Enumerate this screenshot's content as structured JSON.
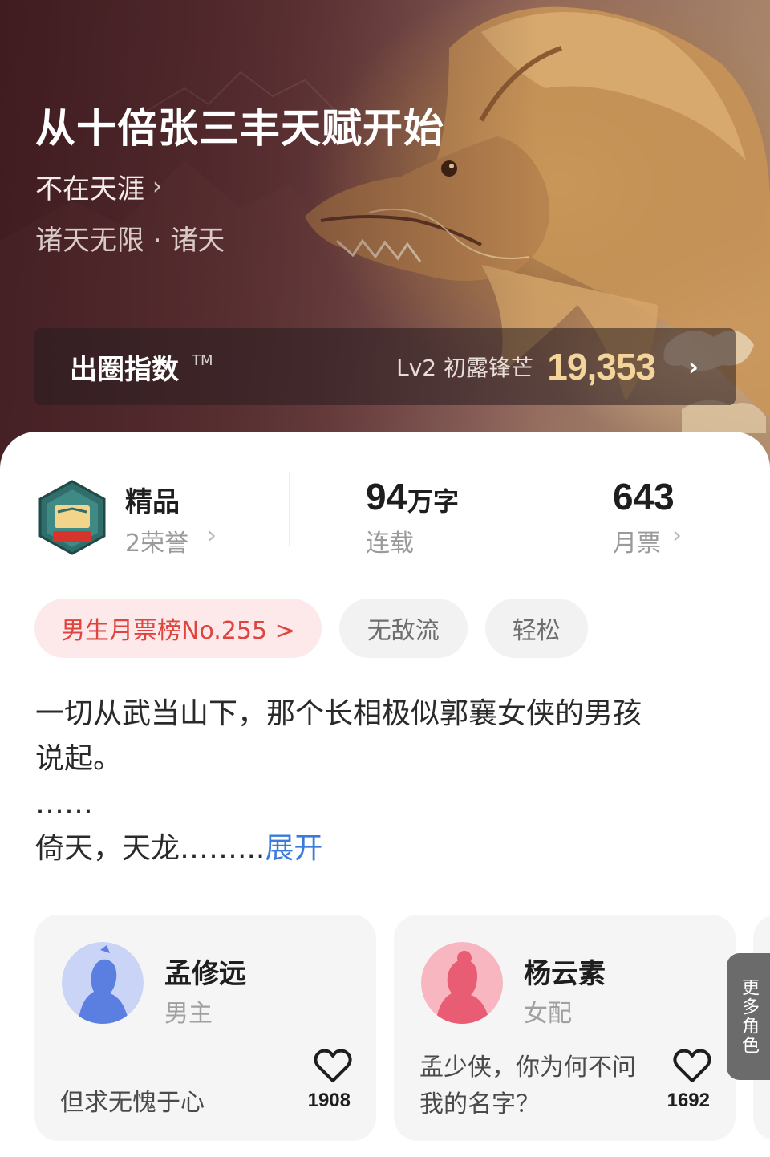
{
  "book": {
    "title": "从十倍张三丰天赋开始",
    "author": "不在天涯",
    "category": "诸天无限 · 诸天"
  },
  "index": {
    "label": "出圈指数",
    "tm": "TM",
    "level": "Lv2 初露锋芒",
    "value": "19,353"
  },
  "stats": {
    "honor_title": "精品",
    "honor_count": "2荣誉",
    "words_num": "94",
    "words_unit": "万字",
    "status": "连载",
    "votes": "643",
    "votes_label": "月票"
  },
  "tags": [
    {
      "label": "男生月票榜No.255 >"
    },
    {
      "label": "无敌流"
    },
    {
      "label": "轻松"
    }
  ],
  "synopsis": {
    "line1": "一切从武当山下，那个长相极似郭襄女侠的男孩",
    "line2": "说起。",
    "line3": "……",
    "line4": "倚天，天龙……...",
    "expand": "展开"
  },
  "characters": [
    {
      "name": "孟修远",
      "role": "男主",
      "quote": "但求无愧于心",
      "likes": "1908"
    },
    {
      "name": "杨云素",
      "role": "女配",
      "quote": "孟少侠，你为何不问我的名字？",
      "likes": "1692"
    }
  ],
  "more_roles": "更多角色",
  "colors": {
    "accent_red": "#e0443f",
    "accent_blue": "#3a7ad8",
    "index_gold": "#f3d59c"
  }
}
